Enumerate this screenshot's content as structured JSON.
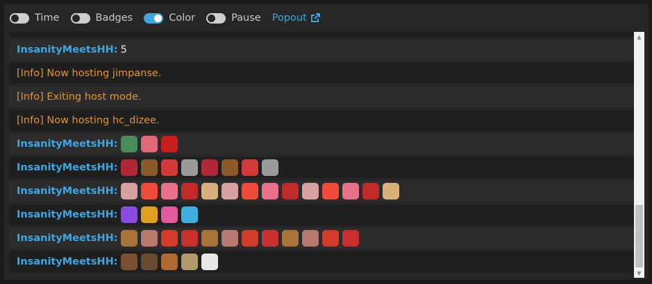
{
  "toolbar": {
    "toggles": [
      {
        "label": "Time",
        "on": false
      },
      {
        "label": "Badges",
        "on": false
      },
      {
        "label": "Color",
        "on": true
      },
      {
        "label": "Pause",
        "on": false
      }
    ],
    "popout_label": "Popout"
  },
  "colors": {
    "username": "#39a9e6",
    "info": "#e8932c",
    "toggle_on": "#40a6e0",
    "link": "#41a7e1"
  },
  "messages": [
    {
      "type": "chat",
      "user": "InsanityMeetsHH",
      "text": "5"
    },
    {
      "type": "info",
      "text": "[Info] Now hosting jimpanse."
    },
    {
      "type": "info",
      "text": "[Info] Exiting host mode."
    },
    {
      "type": "info",
      "text": "[Info] Now hosting hc_dizee."
    },
    {
      "type": "emotes",
      "user": "InsanityMeetsHH",
      "emotes": [
        {
          "name": "fish-rod-emote",
          "color": "#4a8c5a"
        },
        {
          "name": "pink-fish-emote",
          "color": "#e06a7a"
        },
        {
          "name": "red-blob-emote",
          "color": "#c81e1e"
        }
      ]
    },
    {
      "type": "emotes",
      "user": "InsanityMeetsHH",
      "emotes": [
        {
          "name": "cherry-heart-emote",
          "color": "#b02838"
        },
        {
          "name": "owl-emote",
          "color": "#8a5a2a"
        },
        {
          "name": "hype-emote",
          "color": "#d23a3a"
        },
        {
          "name": "rating-emote",
          "color": "#9a9a9a"
        },
        {
          "name": "cherry-heart-emote",
          "color": "#b02838"
        },
        {
          "name": "owl-emote",
          "color": "#8a5a2a"
        },
        {
          "name": "hype-emote",
          "color": "#d23a3a"
        },
        {
          "name": "rating-emote",
          "color": "#9a9a9a"
        }
      ]
    },
    {
      "type": "emotes",
      "user": "InsanityMeetsHH",
      "emotes": [
        {
          "name": "skull-emote",
          "color": "#d8a0a0"
        },
        {
          "name": "heart-emote",
          "color": "#ef4a3a"
        },
        {
          "name": "hug-emote",
          "color": "#e8708a"
        },
        {
          "name": "cherry-emote",
          "color": "#c22a2a"
        },
        {
          "name": "bread-heart-emote",
          "color": "#d9b07a"
        },
        {
          "name": "skull-emote",
          "color": "#d8a0a0"
        },
        {
          "name": "heart-emote",
          "color": "#ef4a3a"
        },
        {
          "name": "hug-emote",
          "color": "#e8708a"
        },
        {
          "name": "cherry-emote",
          "color": "#c22a2a"
        },
        {
          "name": "skull-emote",
          "color": "#d8a0a0"
        },
        {
          "name": "heart-emote",
          "color": "#ef4a3a"
        },
        {
          "name": "hug-emote",
          "color": "#e8708a"
        },
        {
          "name": "cherry-emote",
          "color": "#c22a2a"
        },
        {
          "name": "bread-heart-emote",
          "color": "#d9b07a"
        }
      ]
    },
    {
      "type": "emotes",
      "user": "InsanityMeetsHH",
      "emotes": [
        {
          "name": "rainbow-glitch-emote",
          "color": "#8a4ae0"
        },
        {
          "name": "rainbow-du-emote",
          "color": "#e0a020"
        },
        {
          "name": "rainbow-stack-emote",
          "color": "#e05aa0"
        },
        {
          "name": "rainbow-hug-emote",
          "color": "#40b0e0"
        }
      ]
    },
    {
      "type": "emotes",
      "user": "InsanityMeetsHH",
      "emotes": [
        {
          "name": "box-face-emote",
          "color": "#a8743a"
        },
        {
          "name": "pig-face-emote",
          "color": "#b87a70"
        },
        {
          "name": "skull-mask-emote",
          "color": "#d23a2a"
        },
        {
          "name": "rip-angel-emote",
          "color": "#c83030"
        },
        {
          "name": "box-face-emote",
          "color": "#a8743a"
        },
        {
          "name": "pig-face-emote",
          "color": "#b87a70"
        },
        {
          "name": "skull-mask-emote",
          "color": "#d23a2a"
        },
        {
          "name": "rip-angel-emote",
          "color": "#c83030"
        },
        {
          "name": "box-face-emote",
          "color": "#a8743a"
        },
        {
          "name": "pig-face-emote",
          "color": "#b87a70"
        },
        {
          "name": "skull-mask-emote",
          "color": "#d23a2a"
        },
        {
          "name": "rip-angel-emote",
          "color": "#c83030"
        }
      ]
    },
    {
      "type": "emotes",
      "user": "InsanityMeetsHH",
      "emotes": [
        {
          "name": "face-emote",
          "color": "#7a5030"
        },
        {
          "name": "monkey-emote",
          "color": "#6a4a30"
        },
        {
          "name": "dog-emote",
          "color": "#b06a30"
        },
        {
          "name": "potato-emote",
          "color": "#b09a6a"
        },
        {
          "name": "cat-emote",
          "color": "#e8e8e8"
        }
      ]
    }
  ]
}
